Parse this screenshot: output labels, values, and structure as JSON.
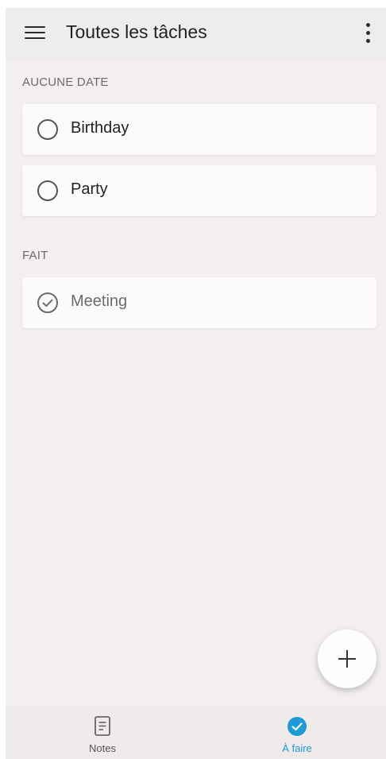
{
  "header": {
    "title": "Toutes les tâches",
    "menu_icon": "hamburger-menu-icon",
    "more_icon": "more-vertical-icon"
  },
  "sections": [
    {
      "label": "AUCUNE DATE",
      "items": [
        {
          "text": "Birthday",
          "done": false
        },
        {
          "text": "Party",
          "done": false
        }
      ]
    },
    {
      "label": "FAIT",
      "items": [
        {
          "text": "Meeting",
          "done": true
        }
      ]
    }
  ],
  "fab": {
    "icon": "plus-icon"
  },
  "bottom_nav": {
    "items": [
      {
        "label": "Notes",
        "icon": "note-icon",
        "active": false
      },
      {
        "label": "À faire",
        "icon": "checkmark-circle-icon",
        "active": true
      }
    ]
  },
  "colors": {
    "accent": "#1e9bd7",
    "background": "#f2efee",
    "card": "#fcfbf9"
  }
}
